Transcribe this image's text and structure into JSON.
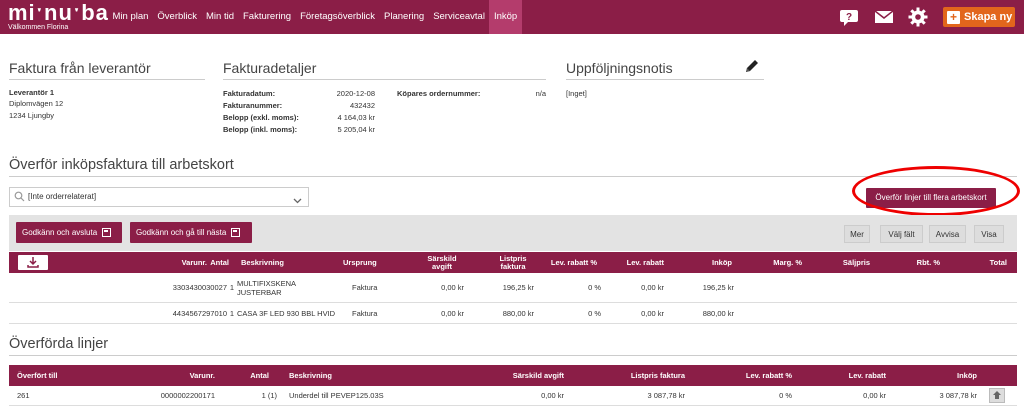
{
  "header": {
    "brand": "miˑnuˑba",
    "welcome": "Välkommen Florina",
    "nav": [
      "Min plan",
      "Överblick",
      "Min tid",
      "Fakturering",
      "Företagsöverblick",
      "Planering",
      "Serviceavtal",
      "Inköp"
    ],
    "active_nav": "Inköp",
    "create_label": "Skapa ny",
    "icons": [
      "help-icon",
      "mail-icon",
      "gear-icon",
      "plus-icon"
    ],
    "colors": {
      "bar": "#8b1e47",
      "active": "#b43c6c",
      "create": "#e2661c"
    }
  },
  "supplier": {
    "title": "Faktura från leverantör",
    "name": "Leverantör 1",
    "street": "Diplomvägen 12",
    "city": "1234 Ljungby"
  },
  "details": {
    "title": "Fakturadetaljer",
    "rows": [
      {
        "label": "Fakturadatum:",
        "value": "2020-12-08"
      },
      {
        "label": "Fakturanummer:",
        "value": "432432"
      },
      {
        "label": "Belopp (exkl. moms):",
        "value": "4 164,03 kr"
      },
      {
        "label": "Belopp (inkl. moms):",
        "value": "5 205,04 kr"
      }
    ],
    "order_label": "Köpares ordernummer:",
    "order_value": "n/a"
  },
  "followup": {
    "title": "Uppföljningsnotis",
    "note": "[Inget]"
  },
  "transfer": {
    "title": "Överför inköpsfaktura till arbetskort",
    "search_value": "[Inte orderrelaterat]",
    "multi_button": "Överför linjer till flera arbetskort",
    "approve_finish": "Godkänn och avsluta",
    "approve_next": "Godkänn och gå till nästa",
    "more": "Mer",
    "choose_field": "Välj fält",
    "reject": "Avvisa",
    "show": "Visa",
    "columns": [
      "Varunr.",
      "Antal",
      "Beskrivning",
      "Ursprung",
      "Särskild avgift",
      "Listpris faktura",
      "Lev. rabatt %",
      "Lev. rabatt",
      "Inköp",
      "Marg. %",
      "Säljpris",
      "Rbt. %",
      "Total"
    ],
    "rows": [
      {
        "varunr": "3303430030027",
        "antal": "1",
        "beskrivning": "MULTIFIXSKENA JUSTERBAR",
        "ursprung": "Faktura",
        "avgift": "0,00 kr",
        "listpris": "196,25 kr",
        "rabattpct": "0 %",
        "rabatt": "0,00 kr",
        "inkop": "196,25 kr"
      },
      {
        "varunr": "4434567297010",
        "antal": "1",
        "beskrivning": "CASA 3F LED 930 BBL HVID",
        "ursprung": "Faktura",
        "avgift": "0,00 kr",
        "listpris": "880,00 kr",
        "rabattpct": "0 %",
        "rabatt": "0,00 kr",
        "inkop": "880,00 kr"
      }
    ]
  },
  "transferred": {
    "title": "Överförda linjer",
    "columns": [
      "Överfört till",
      "Varunr.",
      "Antal",
      "Beskrivning",
      "Särskild avgift",
      "Listpris faktura",
      "Lev. rabatt %",
      "Lev. rabatt",
      "Inköp"
    ],
    "rows": [
      {
        "to": "261",
        "varunr": "0000002200171",
        "antal": "1 (1)",
        "beskrivning": "Underdel till PEVEP125.03S",
        "avgift": "0,00 kr",
        "listpris": "3 087,78 kr",
        "rabattpct": "0 %",
        "rabatt": "0,00 kr",
        "inkop": "3 087,78 kr"
      }
    ]
  }
}
